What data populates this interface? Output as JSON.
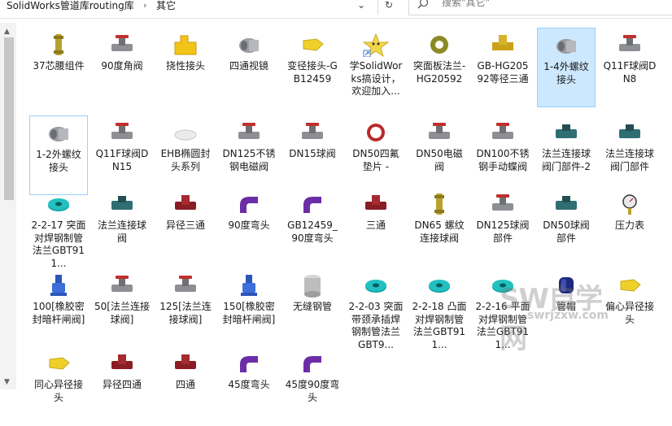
{
  "breadcrumb": {
    "part1": "SolidWorks管道库routing库",
    "part2": "其它"
  },
  "search": {
    "placeholder": "搜索\"其它\""
  },
  "watermark": {
    "big": "SW自学网",
    "url": "swrjzxw.com"
  },
  "items": [
    {
      "label": "37芯腰组件",
      "icon": "part-brass-icon"
    },
    {
      "label": "90度角阀",
      "icon": "part-valve-icon"
    },
    {
      "label": "挠性接头",
      "icon": "folder-part-icon"
    },
    {
      "label": "四通视镜",
      "icon": "part-gray-icon"
    },
    {
      "label": "变径接头-GB12459",
      "icon": "part-yellow-icon"
    },
    {
      "label": "学SolidWorks搞设计，欢迎加入...",
      "icon": "star-shortcut-icon"
    },
    {
      "label": "突面板法兰-HG20592",
      "icon": "part-ring-icon"
    },
    {
      "label": "GB-HG20592等径三通",
      "icon": "part-tee-icon"
    },
    {
      "label": "1-4外螺纹接头",
      "icon": "part-gray-icon"
    },
    {
      "label": "Q11F球阀DN8",
      "icon": "part-valve-icon"
    },
    {
      "label": "1-2外螺纹接头",
      "icon": "part-gray-icon"
    },
    {
      "label": "Q11F球阀DN15",
      "icon": "part-valve-icon"
    },
    {
      "label": "EHB椭圆封头系列",
      "icon": "part-disc-icon"
    },
    {
      "label": "DN125不锈钢电磁阀",
      "icon": "part-valve-icon"
    },
    {
      "label": "DN15球阀",
      "icon": "part-valve-icon"
    },
    {
      "label": "DN50四氟垫片 -",
      "icon": "part-redring-icon"
    },
    {
      "label": "DN50电磁阀",
      "icon": "part-valve-icon"
    },
    {
      "label": "DN100不锈钢手动蝶阀",
      "icon": "part-valve-icon"
    },
    {
      "label": "法兰连接球阀门部件-2",
      "icon": "part-teal-icon"
    },
    {
      "label": "法兰连接球阀门部件",
      "icon": "part-teal-icon"
    },
    {
      "label": "2-2-17 突面对焊钢制管法兰GBT911...",
      "icon": "part-flange-icon"
    },
    {
      "label": "法兰连接球阀",
      "icon": "part-teal-icon"
    },
    {
      "label": "异径三通",
      "icon": "part-maroon-icon"
    },
    {
      "label": "90度弯头",
      "icon": "part-purple-icon"
    },
    {
      "label": "GB12459_90度弯头",
      "icon": "part-purple-icon"
    },
    {
      "label": "三通",
      "icon": "part-maroon-icon"
    },
    {
      "label": "DN65 螺纹连接球阀",
      "icon": "part-brass-icon"
    },
    {
      "label": "DN125球阀部件",
      "icon": "part-valve-icon"
    },
    {
      "label": "DN50球阀部件",
      "icon": "part-teal-icon"
    },
    {
      "label": "压力表",
      "icon": "part-gauge-icon"
    },
    {
      "label": "100[橡胶密封暗杆闸阀]",
      "icon": "part-bluevalve-icon"
    },
    {
      "label": "50[法兰连接球阀]",
      "icon": "part-valve-icon"
    },
    {
      "label": "125[法兰连接球阀]",
      "icon": "part-valve-icon"
    },
    {
      "label": "150[橡胶密封暗杆闸阀]",
      "icon": "part-bluevalve-icon"
    },
    {
      "label": "无缝钢管",
      "icon": "part-pipe-icon"
    },
    {
      "label": "2-2-03 突面带颈承插焊钢制管法兰 GBT9...",
      "icon": "part-flange-icon"
    },
    {
      "label": "2-2-18 凸面对焊钢制管法兰GBT911...",
      "icon": "part-flange-icon"
    },
    {
      "label": "2-2-16 平面对焊钢制管法兰GBT911...",
      "icon": "part-flange-icon"
    },
    {
      "label": "管帽",
      "icon": "part-navy-icon"
    },
    {
      "label": "偏心异径接头",
      "icon": "part-yellow-icon"
    },
    {
      "label": "同心异径接头",
      "icon": "part-yellow-icon"
    },
    {
      "label": "异径四通",
      "icon": "part-maroon-icon"
    },
    {
      "label": "四通",
      "icon": "part-maroon-icon"
    },
    {
      "label": "45度弯头",
      "icon": "part-purple-icon"
    },
    {
      "label": "45度90度弯头",
      "icon": "part-purple-icon"
    }
  ]
}
